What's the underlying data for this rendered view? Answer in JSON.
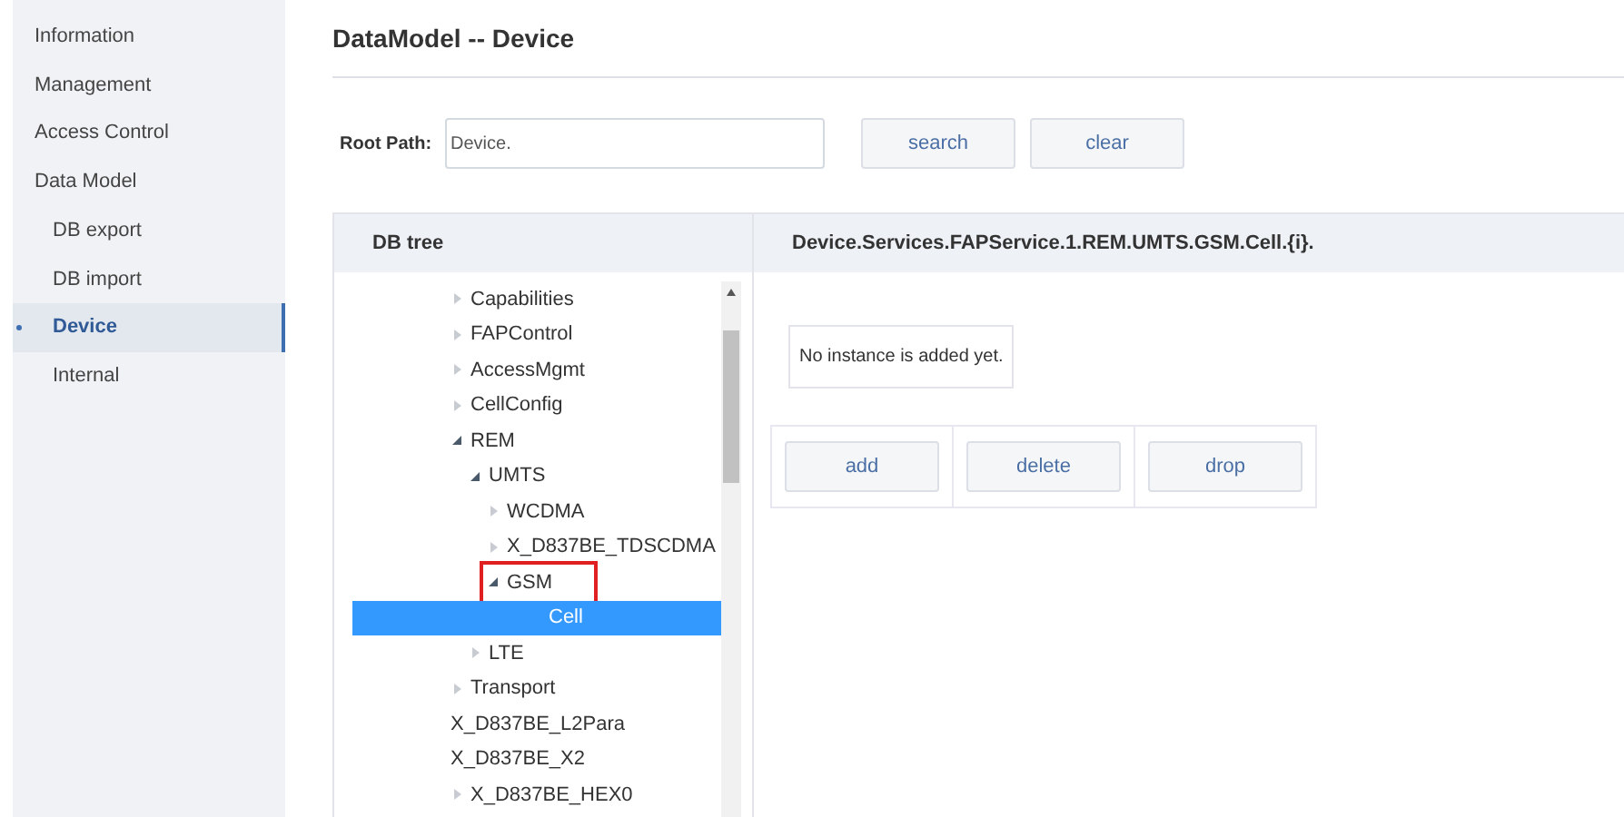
{
  "sidebar": {
    "items": [
      {
        "label": "Information",
        "selected": false,
        "sub": false
      },
      {
        "label": "Management",
        "selected": false,
        "sub": false
      },
      {
        "label": "Access Control",
        "selected": false,
        "sub": false
      },
      {
        "label": "Data Model",
        "selected": false,
        "sub": false
      },
      {
        "label": "DB export",
        "selected": false,
        "sub": true
      },
      {
        "label": "DB import",
        "selected": false,
        "sub": true
      },
      {
        "label": "Device",
        "selected": true,
        "sub": true
      },
      {
        "label": "Internal",
        "selected": false,
        "sub": true
      }
    ]
  },
  "title": "DataModel -- Device",
  "root_path": {
    "label": "Root Path:",
    "value": "Device."
  },
  "buttons": [
    "search",
    "clear"
  ],
  "tree_panel": {
    "header": "DB tree",
    "nodes": [
      {
        "label": "Capabilities",
        "kind": "branch",
        "expanded": false,
        "selected": false
      },
      {
        "label": "FAPControl",
        "kind": "branch",
        "expanded": false,
        "selected": false
      },
      {
        "label": "AccessMgmt",
        "kind": "branch",
        "expanded": false,
        "selected": false
      },
      {
        "label": "CellConfig",
        "kind": "branch",
        "expanded": false,
        "selected": false
      },
      {
        "label": "REM",
        "kind": "branch",
        "expanded": true,
        "selected": false,
        "children": [
          {
            "label": "UMTS",
            "kind": "branch",
            "expanded": true,
            "selected": false,
            "children": [
              {
                "label": "WCDMA",
                "kind": "branch",
                "expanded": false,
                "selected": false
              },
              {
                "label": "X_D837BE_TDSCDMA",
                "kind": "branch",
                "expanded": false,
                "selected": false
              },
              {
                "label": "GSM",
                "kind": "branch",
                "expanded": true,
                "selected": false,
                "highlighted": true,
                "children": [
                  {
                    "label": "Cell",
                    "kind": "leaf",
                    "selected": true
                  }
                ]
              }
            ]
          },
          {
            "label": "LTE",
            "kind": "branch",
            "expanded": false,
            "selected": false
          }
        ]
      },
      {
        "label": "Transport",
        "kind": "branch",
        "expanded": false,
        "selected": false
      },
      {
        "label": "X_D837BE_L2Para",
        "kind": "leaf",
        "selected": false
      },
      {
        "label": "X_D837BE_X2",
        "kind": "leaf",
        "selected": false
      },
      {
        "label": "X_D837BE_HEX0",
        "kind": "branch",
        "expanded": false,
        "selected": false
      }
    ]
  },
  "detail_panel": {
    "header": "Device.Services.FAPService.1.REM.UMTS.GSM.Cell.{i}.",
    "message": "No instance is added yet.",
    "buttons": [
      "add",
      "delete",
      "drop"
    ]
  }
}
